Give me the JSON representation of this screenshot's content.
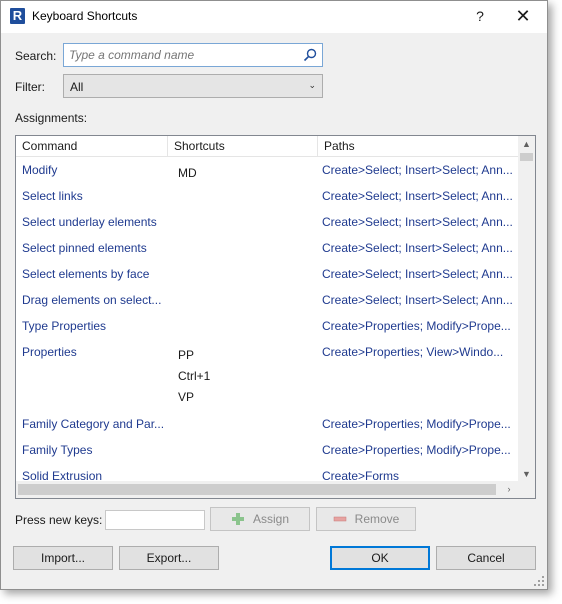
{
  "window": {
    "title": "Keyboard Shortcuts",
    "app_icon_letter": "R",
    "help_label": "?",
    "close_label": "✕"
  },
  "search": {
    "label": "Search:",
    "placeholder": "Type a command name"
  },
  "filter": {
    "label": "Filter:",
    "value": "All",
    "arrow": "⌄"
  },
  "assignments": {
    "label": "Assignments:",
    "columns": [
      "Command",
      "Shortcuts",
      "Paths"
    ],
    "rows": [
      {
        "command": "Modify",
        "shortcuts": [
          "MD"
        ],
        "paths": "Create>Select; Insert>Select; Ann..."
      },
      {
        "command": "Select links",
        "shortcuts": [],
        "paths": "Create>Select; Insert>Select; Ann..."
      },
      {
        "command": "Select underlay elements",
        "shortcuts": [],
        "paths": "Create>Select; Insert>Select; Ann..."
      },
      {
        "command": "Select pinned elements",
        "shortcuts": [],
        "paths": "Create>Select; Insert>Select; Ann..."
      },
      {
        "command": "Select elements by face",
        "shortcuts": [],
        "paths": "Create>Select; Insert>Select; Ann..."
      },
      {
        "command": "Drag elements on select...",
        "shortcuts": [],
        "paths": "Create>Select; Insert>Select; Ann..."
      },
      {
        "command": "Type Properties",
        "shortcuts": [],
        "paths": "Create>Properties; Modify>Prope..."
      },
      {
        "command": "Properties",
        "shortcuts": [
          "PP",
          "Ctrl+1",
          "VP"
        ],
        "paths": "Create>Properties; View>Windo..."
      },
      {
        "command": "Family Category and Par...",
        "shortcuts": [],
        "paths": "Create>Properties; Modify>Prope..."
      },
      {
        "command": "Family Types",
        "shortcuts": [],
        "paths": "Create>Properties; Modify>Prope..."
      },
      {
        "command": "Solid Extrusion",
        "shortcuts": [],
        "paths": "Create>Forms"
      }
    ]
  },
  "keys": {
    "label": "Press new keys:",
    "value": "",
    "assign_label": "Assign",
    "remove_label": "Remove"
  },
  "footer": {
    "import_label": "Import...",
    "export_label": "Export...",
    "ok_label": "OK",
    "cancel_label": "Cancel"
  },
  "colors": {
    "link_text": "#1f3a8f",
    "accent": "#0078d7",
    "assign_icon": "#4caf50",
    "remove_icon": "#d9534f"
  },
  "icons": {
    "search": "magnifier-icon",
    "assign": "plus-icon",
    "remove": "minus-icon"
  }
}
